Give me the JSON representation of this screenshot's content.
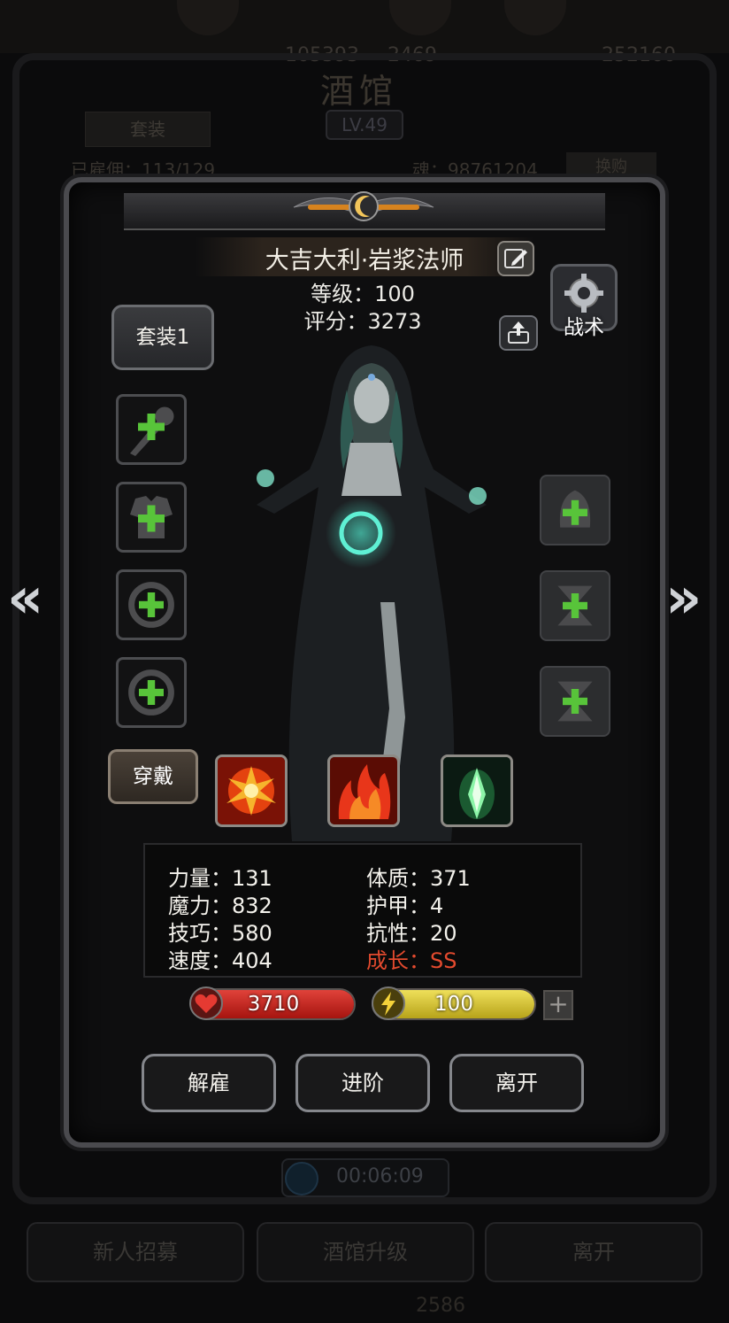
{
  "background": {
    "resource_values": [
      "105393",
      "2469",
      "252160"
    ],
    "title": "酒馆",
    "level": "LV.49",
    "tab_label": "套装",
    "hero_count": "已雇佣：113/129",
    "soul": "魂：98761204",
    "exchange": "换购",
    "timer": "00:06:09",
    "buttons": [
      "新人招募",
      "酒馆升级",
      "离开"
    ],
    "bottom_value": "2586"
  },
  "dialog": {
    "hero_name": "大吉大利·岩浆法师",
    "level_text": "等级：100",
    "score_text": "评分：3273",
    "tactics_label": "战术",
    "suit_label": "套装1",
    "wear_label": "穿戴",
    "left_slots": [
      "weapon-slot",
      "armor-slot",
      "ring-slot",
      "ring-slot"
    ],
    "right_slots": [
      "helmet-slot",
      "boots-slot",
      "boots-slot"
    ],
    "skills": [
      "fire-burst-skill",
      "flame-skill",
      "green-crystal-skill"
    ],
    "stats": {
      "col1": [
        "力量：131",
        "魔力：832",
        "技巧：580",
        "速度：404"
      ],
      "col2": [
        "体质：371",
        "护甲：4",
        "抗性：20",
        "成长：SS"
      ]
    },
    "hp": "3710",
    "energy": "100",
    "actions": [
      "解雇",
      "进阶",
      "离开"
    ]
  },
  "colors": {
    "hp_bar": "#c8221e",
    "energy_bar": "#d8c427",
    "growth_text": "#e34a2e",
    "plus_green": "#58c43a"
  }
}
